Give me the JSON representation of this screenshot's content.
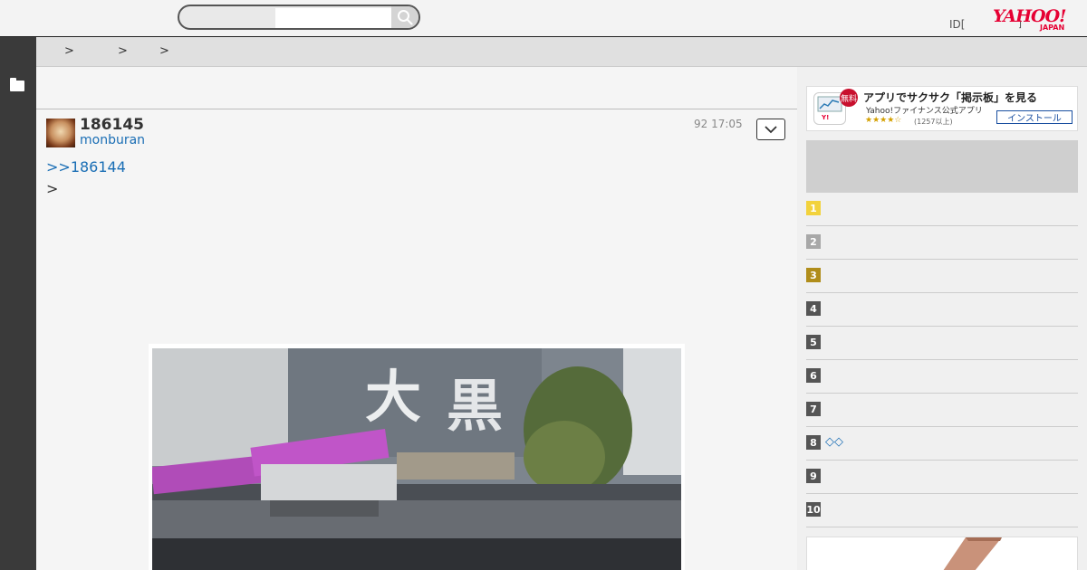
{
  "search": {
    "placeholder": "",
    "value": ""
  },
  "header": {
    "id_link": "ID[",
    "mark": "]",
    "logo_text": "YAHOO!",
    "logo_sub": "JAPAN",
    "brand_color": "#e60033"
  },
  "breadcrumb": [
    "",
    "",
    ""
  ],
  "post": {
    "number": "186145",
    "user": "monburan",
    "date": "92 17:05",
    "reply_to": ">>186144",
    "quote": ">"
  },
  "app_banner": {
    "badge": "無料",
    "title": "アプリでサクサク「掲示板」を見る",
    "subtitle": "Yahoo!ファイナンス公式アプリ",
    "stars": "★★★★☆",
    "review_count": "(1257以上)",
    "install_label": "インストール"
  },
  "ranking": [
    {
      "num": "1",
      "label": "",
      "color": "#f2d23c"
    },
    {
      "num": "2",
      "label": "",
      "color": "#a8a8a8"
    },
    {
      "num": "3",
      "label": "",
      "color": "#b08d1a"
    },
    {
      "num": "4",
      "label": "",
      "color": "#555555"
    },
    {
      "num": "5",
      "label": "",
      "color": "#555555"
    },
    {
      "num": "6",
      "label": "",
      "color": "#555555"
    },
    {
      "num": "7",
      "label": "",
      "color": "#555555"
    },
    {
      "num": "8",
      "label": "◇◇",
      "color": "#555555"
    },
    {
      "num": "9",
      "label": "",
      "color": "#555555"
    },
    {
      "num": "10",
      "label": "",
      "color": "#555555"
    }
  ]
}
